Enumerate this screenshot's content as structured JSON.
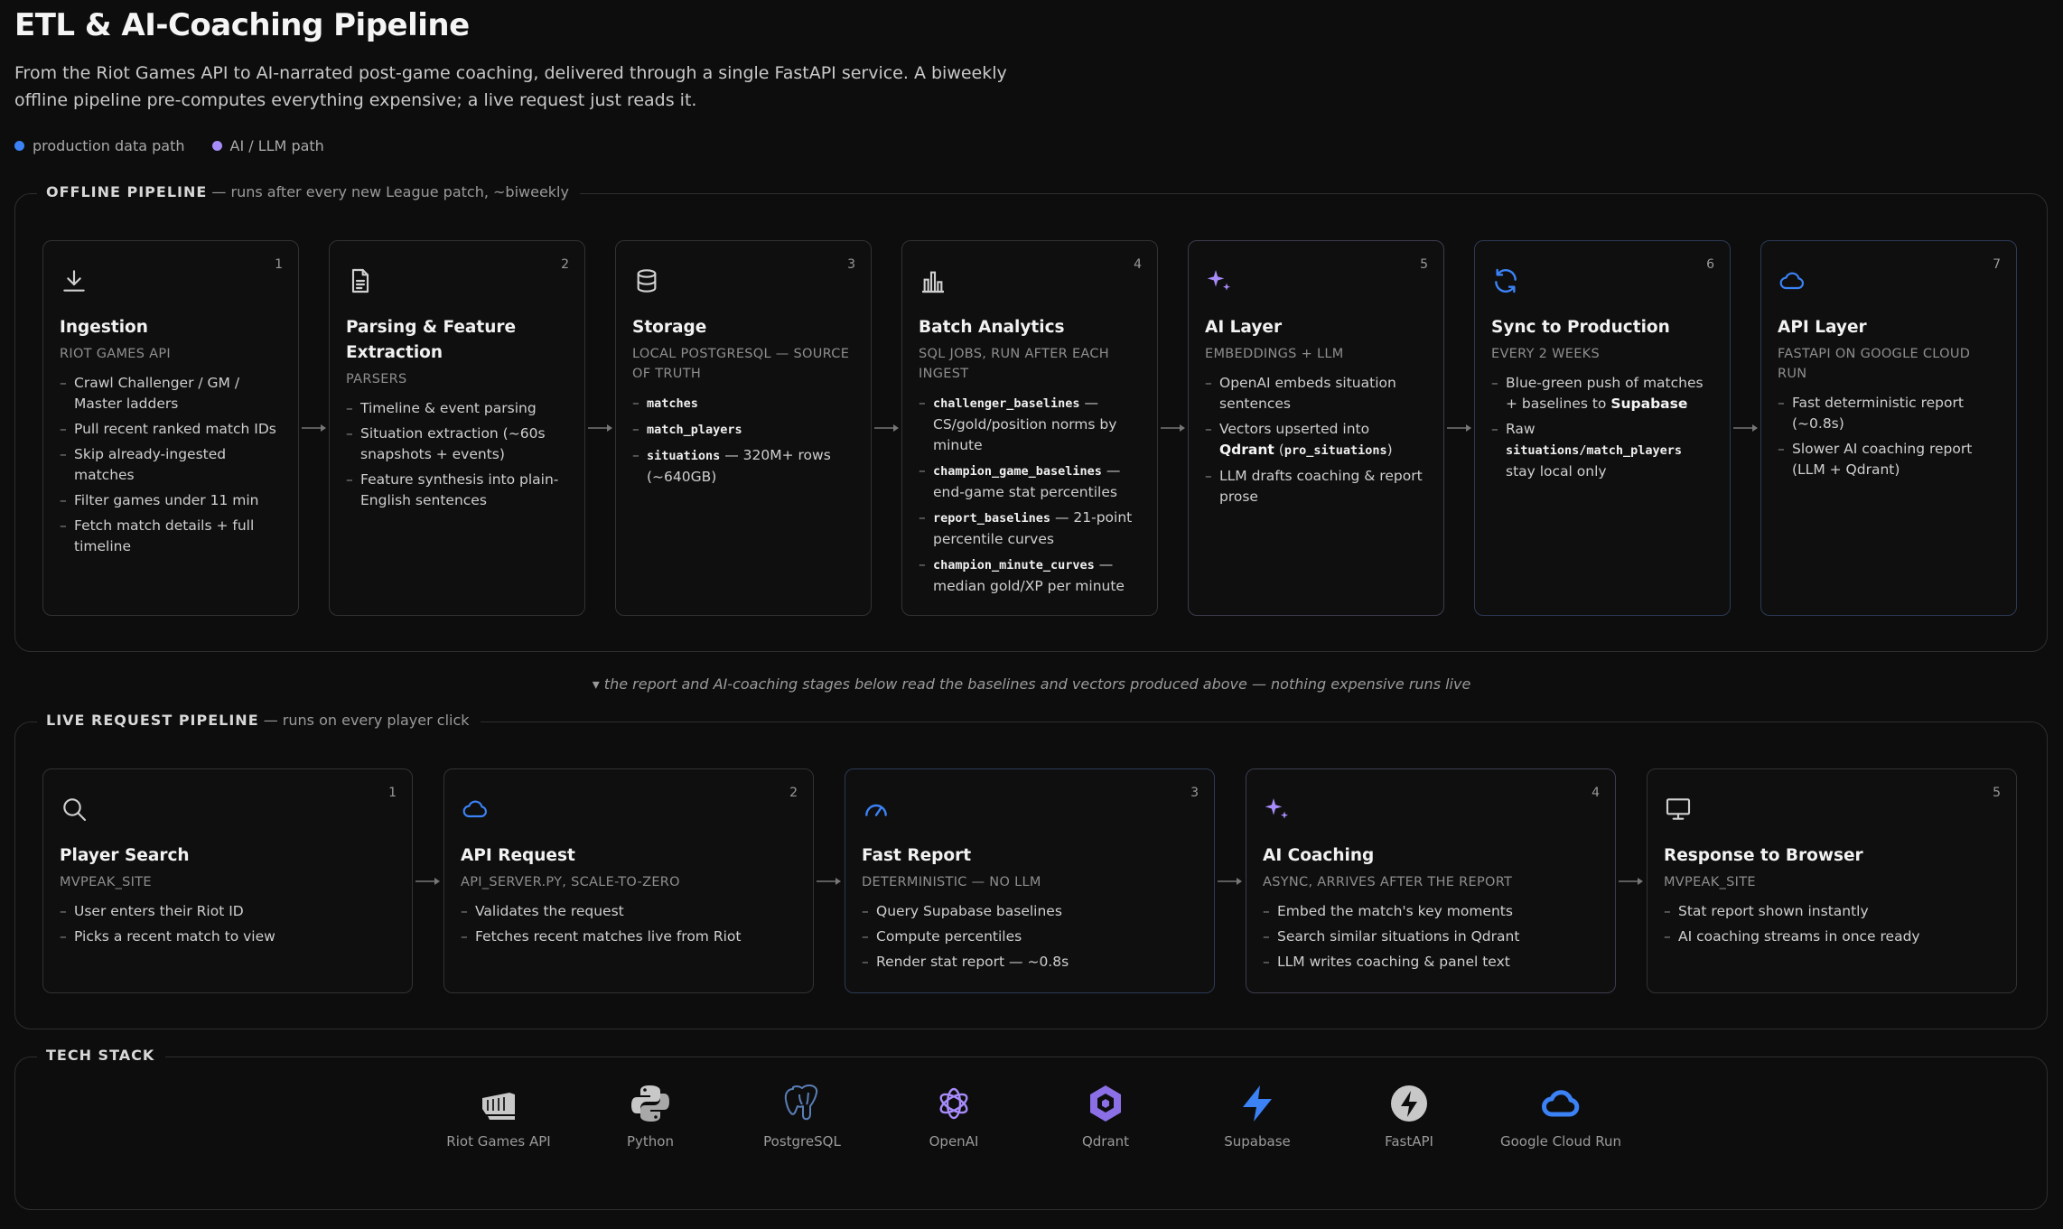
{
  "page": {
    "title": "ETL & AI-Coaching Pipeline",
    "subtitle": "From the Riot Games API to AI-narrated post-game coaching, delivered through a single FastAPI service. A biweekly offline pipeline pre-computes everything expensive; a live request just reads it."
  },
  "legend": [
    {
      "label": "production data path",
      "color": "#3b82f6"
    },
    {
      "label": "AI / LLM path",
      "color": "#a78bfa"
    }
  ],
  "offline": {
    "label": "OFFLINE PIPELINE",
    "desc": "— runs after every new League patch, ~biweekly",
    "cards": [
      {
        "num": "1",
        "icon": "download-icon",
        "title": "Ingestion",
        "sub": "RIOT GAMES API",
        "items": [
          "Crawl Challenger / GM / Master ladders",
          "Pull recent ranked match IDs",
          "Skip already-ingested matches",
          "Filter games under 11 min",
          "Fetch match details + full timeline"
        ]
      },
      {
        "num": "2",
        "icon": "document-icon",
        "title": "Parsing & Feature Extraction",
        "sub": "PARSERS",
        "items": [
          "Timeline & event parsing",
          "Situation extraction (~60s snapshots + events)",
          "Feature synthesis into plain-English sentences"
        ]
      },
      {
        "num": "3",
        "icon": "database-icon",
        "title": "Storage",
        "sub": "LOCAL POSTGRESQL — SOURCE OF TRUTH",
        "items": [
          {
            "code": "matches",
            "text": ""
          },
          {
            "code": "match_players",
            "text": ""
          },
          {
            "code": "situations",
            "text": " — 320M+ rows (~640GB)"
          }
        ]
      },
      {
        "num": "4",
        "icon": "bar-chart-icon",
        "title": "Batch Analytics",
        "sub": "SQL JOBS, RUN AFTER EACH INGEST",
        "items": [
          {
            "code": "challenger_baselines",
            "text": " — CS/gold/position norms by minute"
          },
          {
            "code": "champion_game_baselines",
            "text": " — end-game stat percentiles"
          },
          {
            "code": "report_baselines",
            "text": " — 21-point percentile curves"
          },
          {
            "code": "champion_minute_curves",
            "text": " — median gold/XP per minute"
          }
        ]
      },
      {
        "num": "5",
        "icon": "sparkle-icon",
        "title": "AI Layer",
        "sub": "EMBEDDINGS + LLM",
        "items": [
          "OpenAI embeds situation sentences",
          "Vectors upserted into Qdrant (pro_situations)",
          "LLM drafts coaching & report prose"
        ]
      },
      {
        "num": "6",
        "icon": "sync-icon",
        "title": "Sync to Production",
        "sub": "EVERY 2 WEEKS",
        "items": [
          "Blue-green push of matches + baselines to Supabase",
          "Raw situations/match_players stay local only"
        ]
      },
      {
        "num": "7",
        "icon": "cloud-icon",
        "title": "API Layer",
        "sub": "FASTAPI ON GOOGLE CLOUD RUN",
        "items": [
          "Fast deterministic report (~0.8s)",
          "Slower AI coaching report (LLM + Qdrant)"
        ]
      }
    ]
  },
  "note": "▾ the report and AI-coaching stages below read the baselines and vectors produced above — nothing expensive runs live",
  "live": {
    "label": "LIVE REQUEST PIPELINE",
    "desc": "— runs on every player click",
    "cards": [
      {
        "num": "1",
        "icon": "search-icon",
        "title": "Player Search",
        "sub": "MVPEAK_SITE",
        "items": [
          "User enters their Riot ID",
          "Picks a recent match to view"
        ]
      },
      {
        "num": "2",
        "icon": "cloud-icon",
        "title": "API Request",
        "sub": "API_SERVER.PY, SCALE-TO-ZERO",
        "items": [
          "Validates the request",
          "Fetches recent matches live from Riot"
        ]
      },
      {
        "num": "3",
        "icon": "gauge-icon",
        "title": "Fast Report",
        "sub": "DETERMINISTIC — NO LLM",
        "items": [
          "Query Supabase baselines",
          "Compute percentiles",
          "Render stat report — ~0.8s"
        ]
      },
      {
        "num": "4",
        "icon": "sparkle-icon",
        "title": "AI Coaching",
        "sub": "ASYNC, ARRIVES AFTER THE REPORT",
        "items": [
          "Embed the match's key moments",
          "Search similar situations in Qdrant",
          "LLM writes coaching & panel text"
        ]
      },
      {
        "num": "5",
        "icon": "monitor-icon",
        "title": "Response to Browser",
        "sub": "MVPEAK_SITE",
        "items": [
          "Stat report shown instantly",
          "AI coaching streams in once ready"
        ]
      }
    ]
  },
  "tech": {
    "label": "TECH STACK",
    "items": [
      {
        "name": "Riot Games API",
        "icon": "riot-fist-icon"
      },
      {
        "name": "Python",
        "icon": "python-icon"
      },
      {
        "name": "PostgreSQL",
        "icon": "postgresql-icon"
      },
      {
        "name": "OpenAI",
        "icon": "openai-icon"
      },
      {
        "name": "Qdrant",
        "icon": "qdrant-icon"
      },
      {
        "name": "Supabase",
        "icon": "supabase-icon"
      },
      {
        "name": "FastAPI",
        "icon": "fastapi-icon"
      },
      {
        "name": "Google Cloud Run",
        "icon": "google-cloud-icon"
      }
    ]
  }
}
